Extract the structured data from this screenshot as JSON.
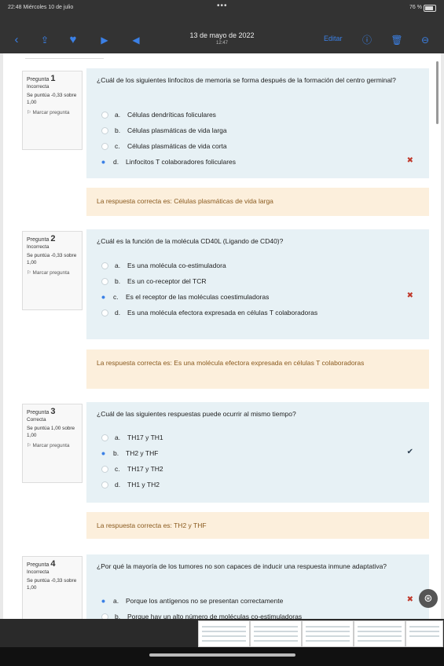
{
  "status": {
    "time_date": "22:48  Miércoles 10 de julio",
    "dots": "•••",
    "right": "76 %"
  },
  "nav": {
    "title": "13 de mayo de 2022",
    "subtitle": "12:47",
    "edit_label": "Editar"
  },
  "questions": [
    {
      "label": "Pregunta",
      "number": "1",
      "state": "Incorrecta",
      "score": "Se puntúa -0,33 sobre 1,00",
      "flag": "Marcar pregunta",
      "text": "¿Cuál de los siguientes linfocitos de memoria se forma después de la formación del centro germinal?",
      "options": [
        {
          "letter": "a.",
          "text": "Células dendríticas foliculares",
          "selected": false
        },
        {
          "letter": "b.",
          "text": "Células plasmáticas de vida larga",
          "selected": false
        },
        {
          "letter": "c.",
          "text": "Células plasmáticas de vida corta",
          "selected": false
        },
        {
          "letter": "d.",
          "text": "Linfocitos T colaboradores foliculares",
          "selected": true
        }
      ],
      "mark": "✖",
      "feedback": "La respuesta correcta es: Células plasmáticas de vida larga"
    },
    {
      "label": "Pregunta",
      "number": "2",
      "state": "Incorrecta",
      "score": "Se puntúa -0,33 sobre 1,00",
      "flag": "Marcar pregunta",
      "text": "¿Cuál es la función de la molécula CD40L (Ligando de CD40)?",
      "options": [
        {
          "letter": "a.",
          "text": "Es una molécula co-estimuladora",
          "selected": false
        },
        {
          "letter": "b.",
          "text": "Es un co-receptor del TCR",
          "selected": false
        },
        {
          "letter": "c.",
          "text": "Es el receptor de las moléculas coestimuladoras",
          "selected": true
        },
        {
          "letter": "d.",
          "text": "Es una molécula efectora expresada en células T colaboradoras",
          "selected": false
        }
      ],
      "mark": "✖",
      "feedback": "La respuesta correcta es: Es una molécula efectora expresada en células T colaboradoras"
    },
    {
      "label": "Pregunta",
      "number": "3",
      "state": "Correcta",
      "score": "Se puntúa 1,00 sobre 1,00",
      "flag": "Marcar pregunta",
      "text": "¿Cuál de las siguientes respuestas puede ocurrir al mismo tiempo?",
      "options": [
        {
          "letter": "a.",
          "text": "TH17 y TH1",
          "selected": false
        },
        {
          "letter": "b.",
          "text": "TH2 y THF",
          "selected": true
        },
        {
          "letter": "c.",
          "text": "TH17 y TH2",
          "selected": false
        },
        {
          "letter": "d.",
          "text": "TH1 y TH2",
          "selected": false
        }
      ],
      "mark": "✔",
      "feedback": "La respuesta correcta es: TH2 y THF"
    },
    {
      "label": "Pregunta",
      "number": "4",
      "state": "Incorrecta",
      "score": "Se puntúa -0,33 sobre 1,00",
      "flag": "",
      "text": "¿Por qué la mayoría de los tumores no son capaces de inducir una respuesta inmune adaptativa?",
      "options": [
        {
          "letter": "a.",
          "text": "Porque los antígenos no se presentan correctamente",
          "selected": true
        },
        {
          "letter": "b.",
          "text": "Porque hay un alto número de moléculas co-estimuladoras",
          "selected": false
        }
      ],
      "mark": "✖",
      "feedback": ""
    }
  ],
  "colors": {
    "accent": "#3b80e6",
    "question_bg": "#e7f1f5",
    "feedback_bg": "#fcefdc",
    "wrong": "#c0392b"
  }
}
